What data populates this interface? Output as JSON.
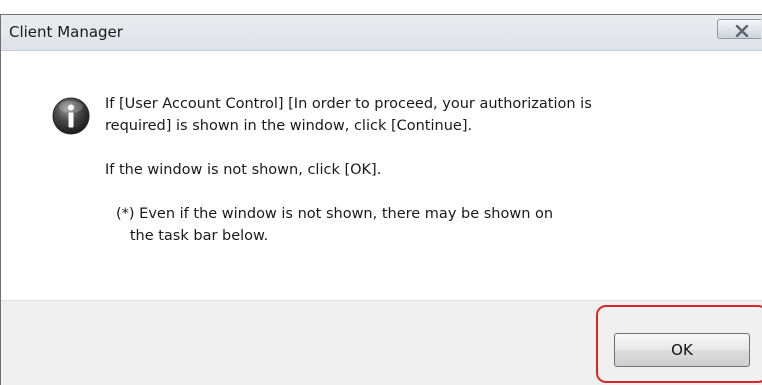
{
  "window": {
    "title": "Client Manager"
  },
  "message": {
    "line1": "If [User Account Control] [In order to proceed, your authorization is\nrequired] is shown in the window, click [Continue].",
    "line2": "If the window is not shown, click [OK].",
    "note": "(*) Even if the window is not shown, there may be shown on\n   the task bar below."
  },
  "buttons": {
    "ok_label": "OK"
  },
  "icons": {
    "dialog_icon": "info-icon",
    "close_icon": "close-icon"
  },
  "colors": {
    "highlight": "#d9262a",
    "footer_bg": "#f0f0f0",
    "titlebar_bg": "#e3e8ee"
  }
}
